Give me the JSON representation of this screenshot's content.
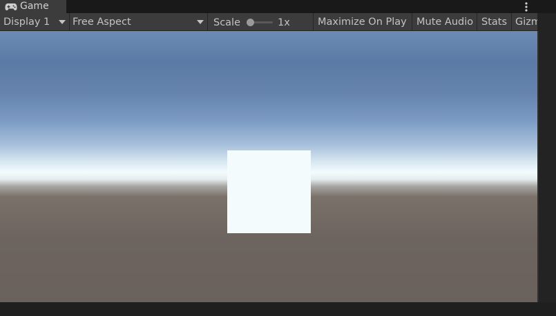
{
  "tab": {
    "icon": "gamepad-icon",
    "label": "Game"
  },
  "menu": {
    "icon": "kebab-menu-icon"
  },
  "toolbar": {
    "display": "Display 1",
    "aspect": "Free Aspect",
    "scale_label": "Scale",
    "scale_value": "1x",
    "maximize_on_play": "Maximize On Play",
    "mute_audio": "Mute Audio",
    "stats": "Stats",
    "gizmos": "Gizm"
  },
  "colors": {
    "toolbar_bg": "#3c3c3c",
    "sky_top": "#5b7aa5",
    "horizon": "#f3fbfd",
    "ground": "#6a615c",
    "cube": "#f3fbfc"
  }
}
